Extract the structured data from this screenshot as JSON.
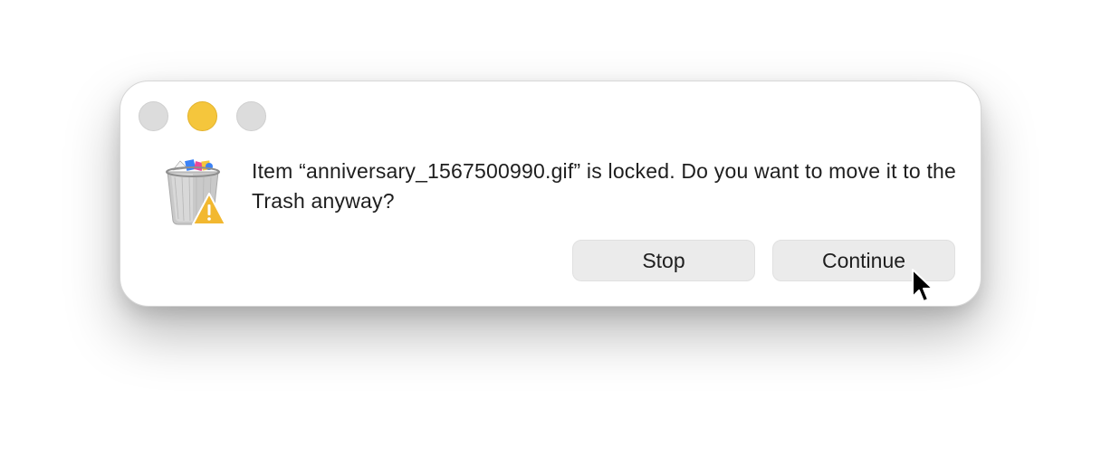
{
  "dialog": {
    "message": "Item “anniversary_1567500990.gif” is locked. Do you want to move it to the Trash anyway?",
    "buttons": {
      "stop_label": "Stop",
      "continue_label": "Continue"
    },
    "icon": "trash-locked-warning-icon"
  },
  "window_controls": {
    "close": "close-button",
    "minimize": "minimize-button",
    "zoom": "zoom-button"
  },
  "colors": {
    "minimize": "#f5c63c",
    "inactive_control": "#dcdcdc",
    "button_bg": "#ebebeb",
    "warning": "#f2b830"
  }
}
